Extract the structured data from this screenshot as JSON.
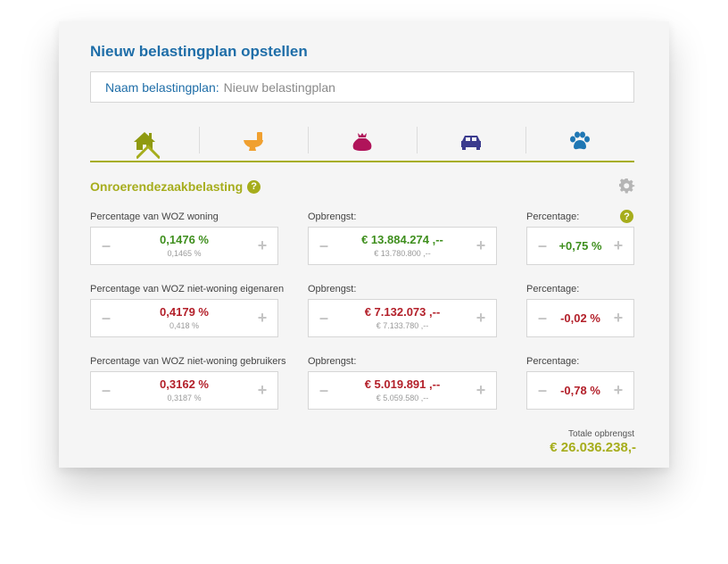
{
  "title": "Nieuw belastingplan opstellen",
  "name_field": {
    "label": "Naam belastingplan:",
    "value": "Nieuw belastingplan"
  },
  "tabs": [
    {
      "icon": "house-icon",
      "color": "#8f9a10",
      "active": true
    },
    {
      "icon": "toilet-icon",
      "color": "#f0a030",
      "active": false
    },
    {
      "icon": "money-bag-icon",
      "color": "#b0145a",
      "active": false
    },
    {
      "icon": "car-icon",
      "color": "#3b3b8e",
      "active": false
    },
    {
      "icon": "paw-icon",
      "color": "#1f77b4",
      "active": false
    }
  ],
  "section": {
    "title": "Onroerendezaakbelasting",
    "help": "?"
  },
  "rows": [
    {
      "label": "Percentage van WOZ woning",
      "value": "0,1476 %",
      "previous": "0,1465 %",
      "revenue_label": "Opbrengst:",
      "revenue": "€ 13.884.274 ,--",
      "revenue_previous": "€ 13.780.800 ,--",
      "pct_label": "Percentage:",
      "pct": "+0,75 %",
      "trend": "up"
    },
    {
      "label": "Percentage van WOZ niet-woning eigenaren",
      "value": "0,4179 %",
      "previous": "0,418 %",
      "revenue_label": "Opbrengst:",
      "revenue": "€ 7.132.073 ,--",
      "revenue_previous": "€ 7.133.780 ,--",
      "pct_label": "Percentage:",
      "pct": "-0,02 %",
      "trend": "down"
    },
    {
      "label": "Percentage van WOZ niet-woning gebruikers",
      "value": "0,3162 %",
      "previous": "0,3187 %",
      "revenue_label": "Opbrengst:",
      "revenue": "€ 5.019.891 ,--",
      "revenue_previous": "€ 5.059.580 ,--",
      "pct_label": "Percentage:",
      "pct": "-0,78 %",
      "trend": "down"
    }
  ],
  "stepper": {
    "minus": "–",
    "plus": "+"
  },
  "total": {
    "label": "Totale opbrengst",
    "value": "€ 26.036.238,-"
  },
  "colors": {
    "title": "#1f6ea8",
    "accent": "#a6ad1c",
    "up": "#3f8f1e",
    "down": "#b3202a"
  }
}
